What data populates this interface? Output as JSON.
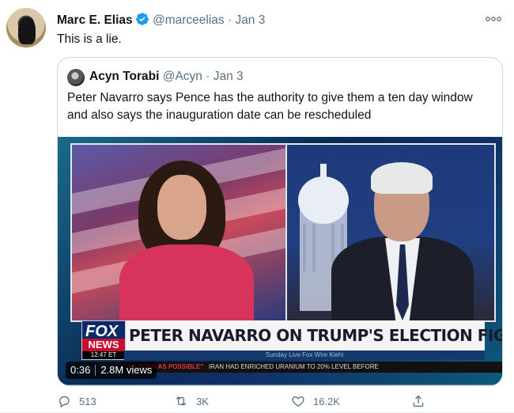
{
  "tweet": {
    "author_name": "Marc E. Elias",
    "handle": "@marceelias",
    "date": "Jan 3",
    "separator": "·",
    "text": "This is a lie."
  },
  "quoted": {
    "author_name": "Acyn Torabi",
    "handle": "@Acyn",
    "date": "Jan 3",
    "separator": "·",
    "text": "Peter Navarro says Pence has the authority to give them a ten day window and also says the inauguration date can be rescheduled"
  },
  "video": {
    "duration": "0:36",
    "views": "2.8M views",
    "progress": 0.0,
    "broadcast": {
      "logo_top": "FOX",
      "logo_bottom": "NEWS",
      "clock": "12:47 ET",
      "headline": "PETER NAVARRO ON TRUMP'S ELECTION FIGHT",
      "subline": "Sunday Live Fox Wire Kiehl",
      "ticker_a": "\"AS SOON AS POSSIBLE\"",
      "ticker_b": "IRAN HAD ENRICHED URANIUM TO 20% LEVEL BEFORE"
    }
  },
  "actions": {
    "replies": "513",
    "retweets": "3K",
    "likes": "16.2K"
  },
  "icons": [
    "verified-badge-icon",
    "more-icon",
    "reply-icon",
    "retweet-icon",
    "like-icon",
    "share-icon"
  ],
  "colors": {
    "verified": "#1d9bf0",
    "muted": "#5b7083",
    "border": "#cfd9de"
  }
}
